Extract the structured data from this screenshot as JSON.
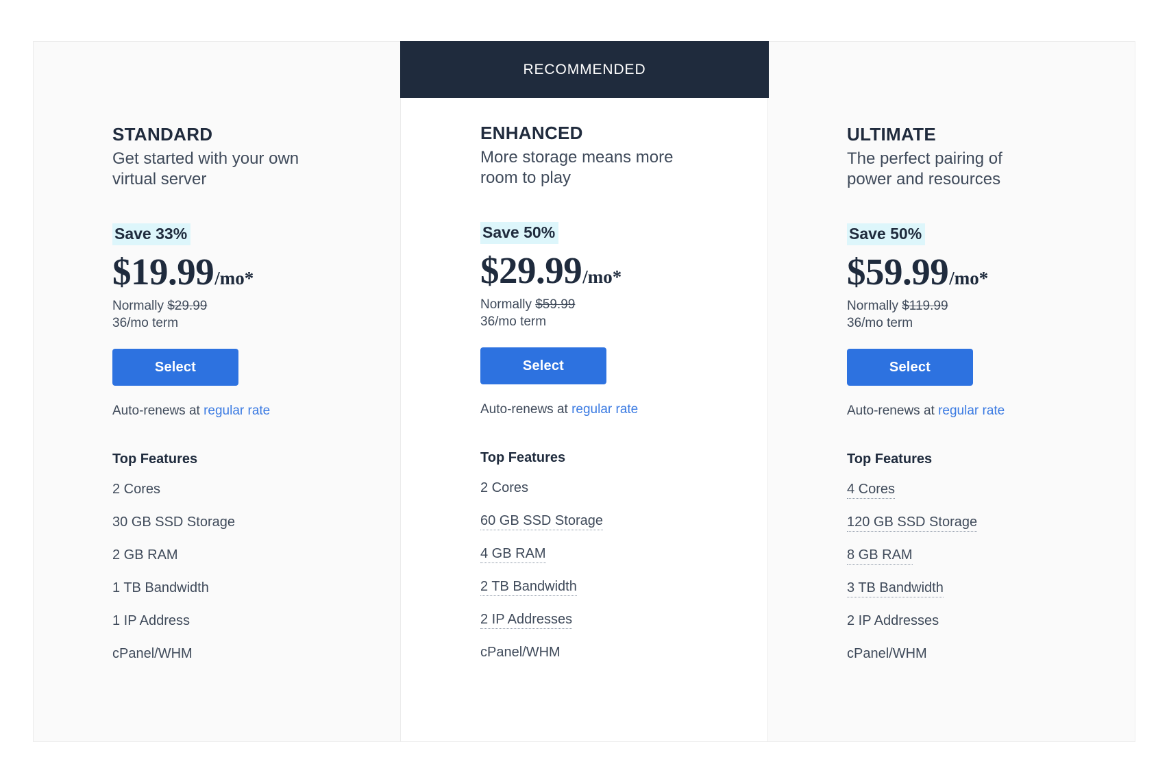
{
  "banner": {
    "label": "RECOMMENDED"
  },
  "common": {
    "save_prefix": "Save",
    "normally_label": "Normally",
    "select_label": "Select",
    "auto_renew_prefix": "Auto-renews at",
    "auto_renew_link": "regular rate",
    "features_heading": "Top Features",
    "price_suffix": "/mo*",
    "term": "36/mo term"
  },
  "colors": {
    "accent_button": "#2d72e0",
    "banner_bg": "#1f2b3d",
    "save_badge_bg": "#ddf6fb",
    "link": "#3a7ae2",
    "heading_text": "#1f2b3d",
    "body_text": "#3f4a5a",
    "card_bg": "#fafafa",
    "featured_card_bg": "#ffffff",
    "card_border": "#ececec"
  },
  "plans": [
    {
      "name": "STANDARD",
      "tagline": "Get started with your own virtual server",
      "save_badge": "Save 33%",
      "price": "$19.99",
      "price_suffix": "/mo*",
      "normally_label": "Normally",
      "normally_price": "$29.99",
      "term": "36/mo term",
      "select_label": "Select",
      "auto_renew_prefix": "Auto-renews at",
      "auto_renew_link": "regular rate",
      "features_heading": "Top Features",
      "features": [
        {
          "text": "2 Cores",
          "highlighted": false
        },
        {
          "text": "30 GB SSD Storage",
          "highlighted": false
        },
        {
          "text": "2 GB RAM",
          "highlighted": false
        },
        {
          "text": "1 TB Bandwidth",
          "highlighted": false
        },
        {
          "text": "1 IP Address",
          "highlighted": false
        },
        {
          "text": "cPanel/WHM",
          "highlighted": false
        }
      ],
      "recommended": false
    },
    {
      "name": "ENHANCED",
      "tagline": "More storage means more room to play",
      "save_badge": "Save 50%",
      "price": "$29.99",
      "price_suffix": "/mo*",
      "normally_label": "Normally",
      "normally_price": "$59.99",
      "term": "36/mo term",
      "select_label": "Select",
      "auto_renew_prefix": "Auto-renews at",
      "auto_renew_link": "regular rate",
      "features_heading": "Top Features",
      "features": [
        {
          "text": "2 Cores",
          "highlighted": false
        },
        {
          "text": "60 GB SSD Storage",
          "highlighted": true
        },
        {
          "text": "4 GB RAM",
          "highlighted": true
        },
        {
          "text": "2 TB Bandwidth",
          "highlighted": true
        },
        {
          "text": "2 IP Addresses",
          "highlighted": true
        },
        {
          "text": "cPanel/WHM",
          "highlighted": false
        }
      ],
      "recommended": true
    },
    {
      "name": "ULTIMATE",
      "tagline": "The perfect pairing of power and resources",
      "save_badge": "Save 50%",
      "price": "$59.99",
      "price_suffix": "/mo*",
      "normally_label": "Normally",
      "normally_price": "$119.99",
      "term": "36/mo term",
      "select_label": "Select",
      "auto_renew_prefix": "Auto-renews at",
      "auto_renew_link": "regular rate",
      "features_heading": "Top Features",
      "features": [
        {
          "text": "4 Cores",
          "highlighted": true
        },
        {
          "text": "120 GB SSD Storage",
          "highlighted": true
        },
        {
          "text": "8 GB RAM",
          "highlighted": true
        },
        {
          "text": "3 TB Bandwidth",
          "highlighted": true
        },
        {
          "text": "2 IP Addresses",
          "highlighted": false
        },
        {
          "text": "cPanel/WHM",
          "highlighted": false
        }
      ],
      "recommended": false
    }
  ]
}
